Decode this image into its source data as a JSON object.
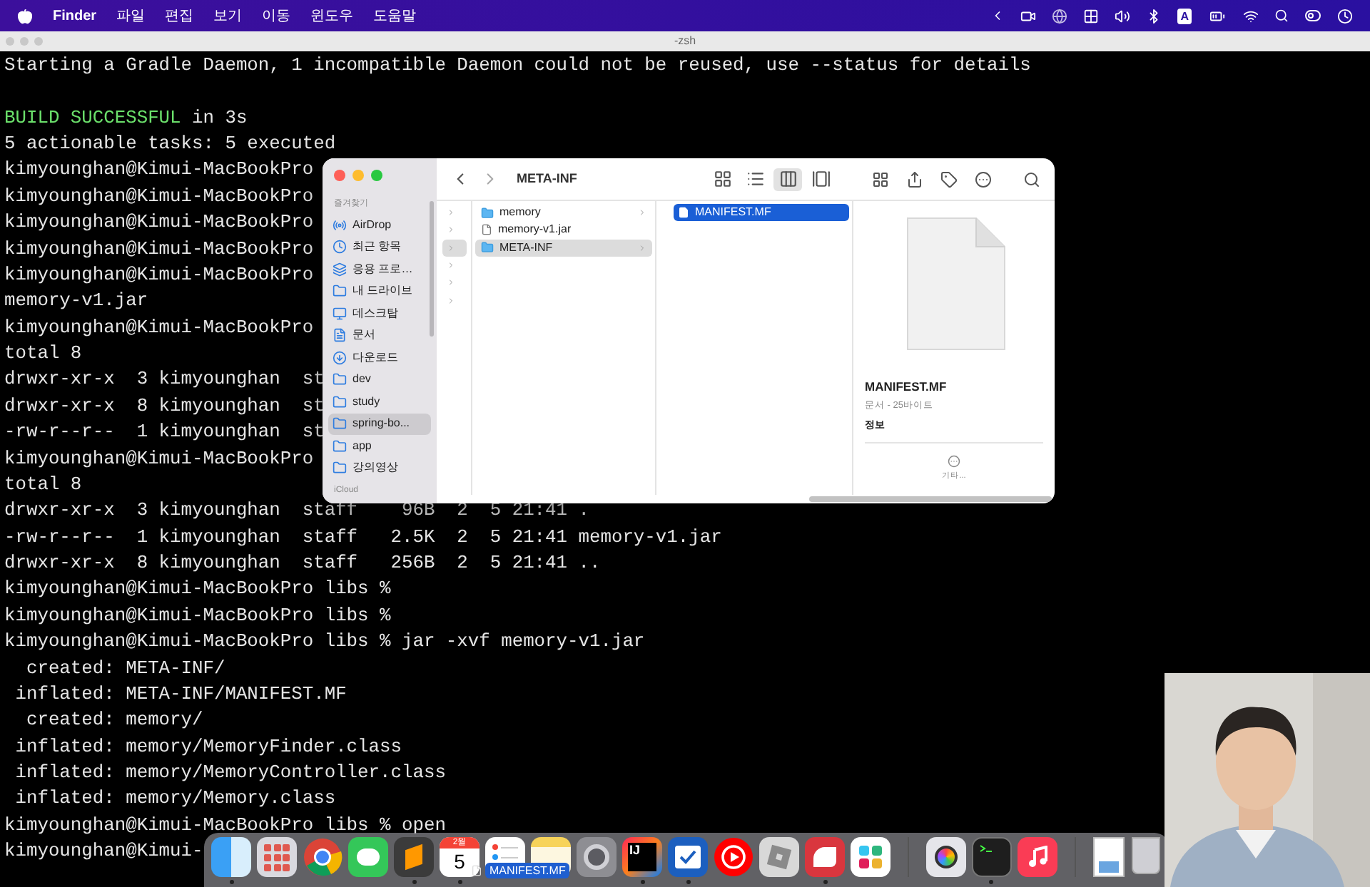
{
  "menu_bar": {
    "app_name": "Finder",
    "menus": [
      "파일",
      "편집",
      "보기",
      "이동",
      "윈도우",
      "도움말"
    ],
    "input_source": "A"
  },
  "terminal": {
    "title": "-zsh",
    "lines": [
      {
        "segments": [
          {
            "kind": "plain",
            "text": "Starting a Gradle Daemon, 1 incompatible Daemon could not be reused, use --status for details"
          }
        ]
      },
      {
        "blank_before": true,
        "segments": [
          {
            "kind": "success",
            "text": "BUILD SUCCESSFUL"
          },
          {
            "kind": "plain",
            "text": " in 3s"
          }
        ]
      },
      {
        "segments": [
          {
            "kind": "plain",
            "text": "5 actionable tasks: 5 executed"
          }
        ]
      },
      {
        "segments": [
          {
            "kind": "plain",
            "text": "kimyounghan@Kimui-MacBookPro"
          }
        ]
      },
      {
        "segments": [
          {
            "kind": "plain",
            "text": "kimyounghan@Kimui-MacBookPro"
          }
        ]
      },
      {
        "segments": [
          {
            "kind": "plain",
            "text": "kimyounghan@Kimui-MacBookPro"
          }
        ]
      },
      {
        "segments": [
          {
            "kind": "plain",
            "text": "kimyounghan@Kimui-MacBookPro"
          }
        ]
      },
      {
        "segments": [
          {
            "kind": "plain",
            "text": "kimyounghan@Kimui-MacBookPro"
          }
        ]
      },
      {
        "segments": [
          {
            "kind": "plain",
            "text": "memory-v1.jar"
          }
        ]
      },
      {
        "segments": [
          {
            "kind": "plain",
            "text": "kimyounghan@Kimui-MacBookPro"
          }
        ]
      },
      {
        "segments": [
          {
            "kind": "plain",
            "text": "total 8"
          }
        ]
      },
      {
        "segments": [
          {
            "kind": "plain",
            "text": "drwxr-xr-x  3 kimyounghan  st"
          }
        ]
      },
      {
        "segments": [
          {
            "kind": "plain",
            "text": "drwxr-xr-x  8 kimyounghan  st"
          }
        ]
      },
      {
        "segments": [
          {
            "kind": "plain",
            "text": "-rw-r--r--  1 kimyounghan  st"
          }
        ]
      },
      {
        "segments": [
          {
            "kind": "plain",
            "text": "kimyounghan@Kimui-MacBookPro"
          }
        ]
      },
      {
        "segments": [
          {
            "kind": "plain",
            "text": "total 8"
          }
        ]
      },
      {
        "segments": [
          {
            "kind": "plain",
            "text": "drwxr-xr-x  3 kimyounghan  staff    96B  2  5 21:41 ."
          }
        ]
      },
      {
        "segments": [
          {
            "kind": "plain",
            "text": "-rw-r--r--  1 kimyounghan  staff   2.5K  2  5 21:41 memory-v1.jar"
          }
        ]
      },
      {
        "segments": [
          {
            "kind": "plain",
            "text": "drwxr-xr-x  8 kimyounghan  staff   256B  2  5 21:41 .."
          }
        ]
      },
      {
        "segments": [
          {
            "kind": "plain",
            "text": "kimyounghan@Kimui-MacBookPro libs %"
          }
        ]
      },
      {
        "segments": [
          {
            "kind": "plain",
            "text": "kimyounghan@Kimui-MacBookPro libs %"
          }
        ]
      },
      {
        "segments": [
          {
            "kind": "plain",
            "text": "kimyounghan@Kimui-MacBookPro libs % jar -xvf memory-v1.jar"
          }
        ]
      },
      {
        "segments": [
          {
            "kind": "plain",
            "text": "  created: META-INF/"
          }
        ]
      },
      {
        "segments": [
          {
            "kind": "plain",
            "text": " inflated: META-INF/MANIFEST.MF"
          }
        ]
      },
      {
        "segments": [
          {
            "kind": "plain",
            "text": "  created: memory/"
          }
        ]
      },
      {
        "segments": [
          {
            "kind": "plain",
            "text": " inflated: memory/MemoryFinder.class"
          }
        ]
      },
      {
        "segments": [
          {
            "kind": "plain",
            "text": " inflated: memory/MemoryController.class"
          }
        ]
      },
      {
        "segments": [
          {
            "kind": "plain",
            "text": " inflated: memory/Memory.class"
          }
        ]
      },
      {
        "segments": [
          {
            "kind": "plain",
            "text": "kimyounghan@Kimui-MacBookPro libs % open"
          }
        ]
      },
      {
        "segments": [
          {
            "kind": "plain",
            "text": "kimyounghan@Kimui-"
          }
        ]
      }
    ]
  },
  "finder": {
    "title": "META-INF",
    "view_modes": [
      {
        "kind": "icons",
        "selected": false
      },
      {
        "kind": "list",
        "selected": false
      },
      {
        "kind": "columns",
        "selected": true
      },
      {
        "kind": "gallery",
        "selected": false
      }
    ],
    "sidebar": {
      "section": "즐겨찾기",
      "items": [
        {
          "kind": "airdrop",
          "label": "AirDrop",
          "selected": false
        },
        {
          "kind": "recent",
          "label": "최근 항목",
          "selected": false
        },
        {
          "kind": "apps",
          "label": "응용 프로…",
          "selected": false
        },
        {
          "kind": "folder",
          "label": "내 드라이브",
          "selected": false
        },
        {
          "kind": "desktop",
          "label": "데스크탑",
          "selected": false
        },
        {
          "kind": "document",
          "label": "문서",
          "selected": false
        },
        {
          "kind": "download",
          "label": "다운로드",
          "selected": false
        },
        {
          "kind": "folder",
          "label": "dev",
          "selected": false
        },
        {
          "kind": "folder",
          "label": "study",
          "selected": false
        },
        {
          "kind": "folder",
          "label": "spring-bo...",
          "selected": true
        },
        {
          "kind": "folder",
          "label": "app",
          "selected": false
        },
        {
          "kind": "folder",
          "label": "강의영상",
          "selected": false
        }
      ],
      "next_section": "iCloud"
    },
    "path_column": [
      {
        "selected": false
      },
      {
        "selected": false
      },
      {
        "selected": true
      },
      {
        "selected": false
      },
      {
        "selected": false
      },
      {
        "selected": false
      }
    ],
    "column_2": [
      {
        "kind": "folder",
        "name": "memory",
        "selected": false
      },
      {
        "kind": "jar",
        "name": "memory-v1.jar",
        "selected": false
      },
      {
        "kind": "folder",
        "name": "META-INF",
        "selected": true
      }
    ],
    "column_3": [
      {
        "kind": "file",
        "name": "MANIFEST.MF",
        "selected": true
      }
    ],
    "preview": {
      "name": "MANIFEST.MF",
      "info": "문서 - 25바이트",
      "section": "정보",
      "more": "기타..."
    }
  },
  "dock": {
    "items": [
      {
        "kind": "finder",
        "running": true
      },
      {
        "kind": "launchpad",
        "running": false
      },
      {
        "kind": "chrome",
        "running": false
      },
      {
        "kind": "messages",
        "running": false
      },
      {
        "kind": "sublime",
        "running": true
      },
      {
        "kind": "calendar",
        "running": true,
        "month": "2월",
        "day": "5"
      },
      {
        "kind": "reminders",
        "running": false
      },
      {
        "kind": "notes",
        "running": false
      },
      {
        "kind": "settings",
        "running": false
      },
      {
        "kind": "intellij",
        "running": true,
        "label": "IJ"
      },
      {
        "kind": "tasks",
        "running": true
      },
      {
        "kind": "youtube",
        "running": false
      },
      {
        "kind": "roblox",
        "running": false
      },
      {
        "kind": "bear",
        "running": true
      },
      {
        "kind": "slack",
        "running": false
      },
      {
        "kind": "separator"
      },
      {
        "kind": "photobooth",
        "running": false
      },
      {
        "kind": "terminal",
        "running": true
      },
      {
        "kind": "music",
        "running": false
      },
      {
        "kind": "separator"
      },
      {
        "kind": "preview",
        "running": false
      },
      {
        "kind": "trash",
        "running": false
      }
    ],
    "drag_label": "MANIFEST.MF"
  }
}
